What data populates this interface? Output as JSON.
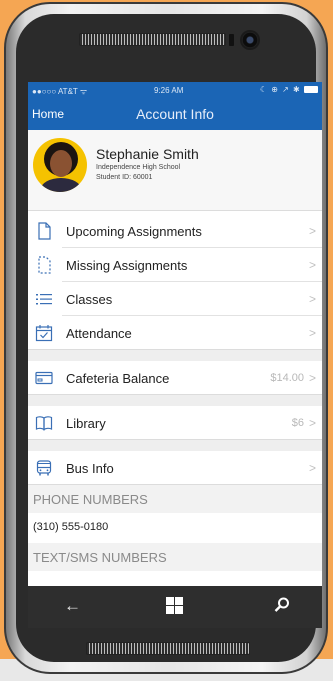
{
  "status_bar": {
    "carrier": "●●○○○ AT&T ᯤ",
    "time": "9:26 AM",
    "icons": "☾ ⊕ ↗ ✱"
  },
  "nav": {
    "home_label": "Home",
    "title": "Account Info"
  },
  "profile": {
    "name": "Stephanie Smith",
    "school": "Independence High School",
    "student_id": "Student ID: 60001"
  },
  "menu": [
    {
      "label": "Upcoming Assignments",
      "icon": "document-icon"
    },
    {
      "label": "Missing Assignments",
      "icon": "dashed-document-icon"
    },
    {
      "label": "Classes",
      "icon": "list-icon"
    },
    {
      "label": "Attendance",
      "icon": "calendar-check-icon"
    },
    {
      "label": "Cafeteria Balance",
      "value": "$14.00",
      "icon": "card-icon"
    },
    {
      "label": "Library",
      "value": "$6",
      "icon": "book-icon"
    },
    {
      "label": "Bus Info",
      "icon": "bus-icon"
    }
  ],
  "chevron": ">",
  "phone_numbers": {
    "header": "PHONE NUMBERS",
    "items": [
      "(310) 555-0180"
    ]
  },
  "sms_numbers": {
    "header": "TEXT/SMS NUMBERS"
  },
  "bottom_bar": {
    "back": "←"
  },
  "colors": {
    "accent": "#1b65b5",
    "background": "#f5a653",
    "icon_blue": "#3a6fb5"
  }
}
